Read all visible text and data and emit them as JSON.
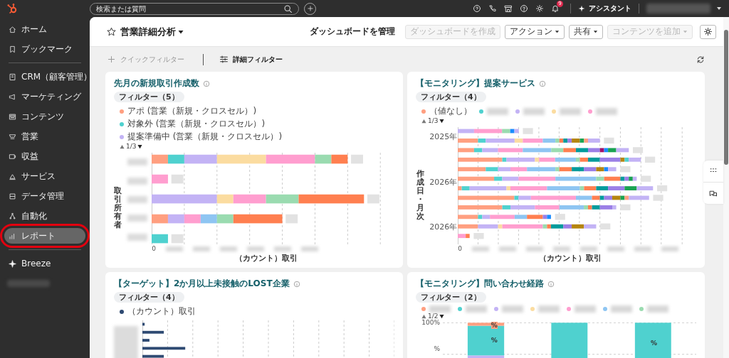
{
  "top_bar": {
    "search": {
      "placeholder": "検索または質問"
    },
    "notification_badge": "9",
    "assistant": "アシスタント"
  },
  "sidebar": {
    "groups": [
      {
        "items": [
          {
            "label": "ホーム",
            "selected": false
          },
          {
            "label": "ブックマーク",
            "selected": false
          }
        ]
      },
      {
        "items": [
          {
            "label": "CRM（顧客管理）",
            "selected": false
          },
          {
            "label": "マーケティング",
            "selected": false
          },
          {
            "label": "コンテンツ",
            "selected": false
          },
          {
            "label": "営業",
            "selected": false
          },
          {
            "label": "収益",
            "selected": false
          },
          {
            "label": "サービス",
            "selected": false
          },
          {
            "label": "データ管理",
            "selected": false
          },
          {
            "label": "自動化",
            "selected": false
          },
          {
            "label": "レポート",
            "selected": true
          }
        ]
      },
      {
        "items": [
          {
            "label": "Breeze",
            "selected": false
          }
        ]
      }
    ]
  },
  "dashboard": {
    "title": "営業詳細分析",
    "favorite": false,
    "manage_link": "ダッシュボードを管理",
    "buttons": [
      {
        "label": "ダッシュボードを作成",
        "disabled": true,
        "dropdown": false
      },
      {
        "label": "アクション",
        "disabled": false,
        "dropdown": true
      },
      {
        "label": "共有",
        "disabled": false,
        "dropdown": true
      },
      {
        "label": "コンテンツを追加",
        "disabled": true,
        "dropdown": true
      }
    ]
  },
  "filters": {
    "quick_filter": "クイックフィルター",
    "advanced_filter": "詳細フィルター"
  },
  "reports": [
    {
      "kind": "owner-bars",
      "title": "先月の新規取引作成数",
      "filter_badge": "フィルター（5）",
      "legend": [
        {
          "label": "アポ (営業（新規・クロスセル）)",
          "color": "#ff9f80"
        },
        {
          "label": "対象外 (営業（新規・クロスセル）)",
          "color": "#4fd1cf"
        },
        {
          "label": "提案準備中 (営業（新規・クロスセル）)",
          "color": "#c3b3f5"
        }
      ],
      "pager": "1/3",
      "y_axis_title": "取引所有者",
      "x_ticks": [
        "0"
      ],
      "x_axis_title": "（カウント）取引"
    },
    {
      "kind": "monthly-bars",
      "title": "【モニタリング】提案サービス",
      "filter_badge": "フィルター（4）",
      "legend": [
        {
          "label": "（値なし）",
          "color": "#ff9f80"
        },
        {
          "color": "#4fd1cf"
        },
        {
          "color": "#c3b3f5"
        },
        {
          "color": "#fbdca0"
        },
        {
          "color": "#ff9ecf"
        }
      ],
      "pager": "1/3",
      "y_axis_title": "作成日・月次",
      "y_labels": [
        "2025年",
        "2026年",
        "2026年"
      ],
      "x_ticks": [
        "0"
      ],
      "x_axis_title": "（カウント）取引"
    },
    {
      "kind": "count-bars",
      "title": "【ターゲット】2か月以上未接触のLOST企業",
      "filter_badge": "フィルター（4）",
      "legend": [
        {
          "label": "（カウント）取引",
          "color": "#2e4a72"
        }
      ]
    },
    {
      "kind": "percent-columns",
      "title": "【モニタリング】問い合わせ経路",
      "filter_badge": "フィルター（2）",
      "legend": [
        {
          "color": "#ff9f80"
        },
        {
          "color": "#4fd1cf"
        },
        {
          "color": "#c3b3f5"
        },
        {
          "color": "#fbdca0"
        },
        {
          "color": "#ff9ecf"
        },
        {
          "color": "#8ec5f2"
        },
        {
          "color": "#9adbb0"
        }
      ],
      "pager": "1/2",
      "y_ticks": [
        "100%",
        "%"
      ],
      "bar_labels": [
        "%",
        "%",
        "%"
      ]
    }
  ]
}
